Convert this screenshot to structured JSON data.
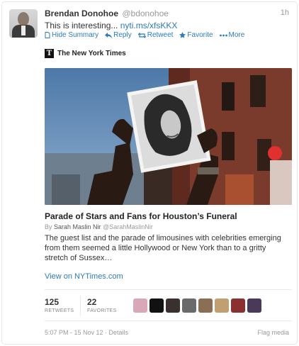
{
  "tweet": {
    "name": "Brendan Donohoe",
    "handle": "@bdonohoe",
    "time": "1h",
    "text": "This is interesting...",
    "link": "nyti.ms/xfsKKX"
  },
  "actions": {
    "hide_summary": "Hide Summary",
    "reply": "Reply",
    "retweet": "Retweet",
    "favorite": "Favorite",
    "more": "More"
  },
  "card": {
    "source": "The New York Times",
    "source_logo_letter": "T",
    "headline": "Parade of Stars and Fans for Houston’s Funeral",
    "byline_prefix": "By",
    "author": "Sarah Maslin Nir",
    "author_handle": "@SarahMaslinNir",
    "summary": "The guest list and the parade of limousines with celebrities emerging from them seemed a little Hollywood or New York than to a gritty stretch of Sussex…",
    "view_link": "View on NYTimes.com"
  },
  "stats": {
    "retweets_count": "125",
    "retweets_label": "RETWEETS",
    "favorites_count": "22",
    "favorites_label": "FAVORITES"
  },
  "favoriters": [
    {
      "icon": "user-avatar-pink",
      "color": "#d8a8b8"
    },
    {
      "icon": "user-avatar-black",
      "color": "#111111"
    },
    {
      "icon": "user-avatar-dark",
      "color": "#3a3030"
    },
    {
      "icon": "user-avatar-gray",
      "color": "#6a6a6a"
    },
    {
      "icon": "user-avatar-brown",
      "color": "#8a6e55"
    },
    {
      "icon": "user-avatar-tan",
      "color": "#c0a070"
    },
    {
      "icon": "user-avatar-red",
      "color": "#8a3030"
    },
    {
      "icon": "user-avatar-purple",
      "color": "#4a3a5a"
    }
  ],
  "footer": {
    "timestamp": "5:07 PM - 15 Nov 12 · Details",
    "flag": "Flag media"
  },
  "colors": {
    "link": "#2b7bb9",
    "muted": "#999999"
  }
}
